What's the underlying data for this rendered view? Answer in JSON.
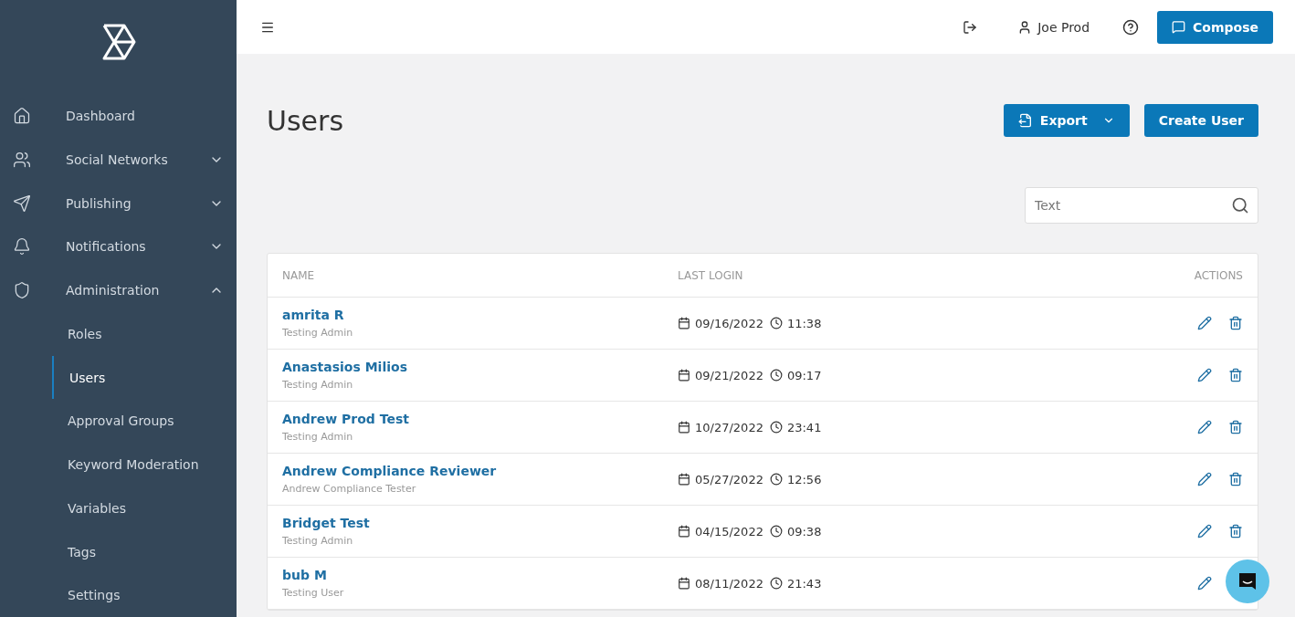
{
  "sidebar": {
    "items": [
      {
        "label": "Dashboard"
      },
      {
        "label": "Social Networks",
        "expanded": false
      },
      {
        "label": "Publishing",
        "expanded": false
      },
      {
        "label": "Notifications",
        "expanded": false
      },
      {
        "label": "Administration",
        "expanded": true,
        "children": [
          {
            "label": "Roles",
            "selected": false
          },
          {
            "label": "Users",
            "selected": true
          },
          {
            "label": "Approval Groups",
            "selected": false
          },
          {
            "label": "Keyword Moderation",
            "selected": false
          },
          {
            "label": "Variables",
            "selected": false
          },
          {
            "label": "Tags",
            "selected": false
          },
          {
            "label": "Settings",
            "selected": false
          }
        ]
      }
    ]
  },
  "header": {
    "user": "Joe Prod",
    "compose": "Compose"
  },
  "page": {
    "title": "Users",
    "export": "Export",
    "create": "Create User",
    "search": {
      "placeholder": "Text"
    }
  },
  "table": {
    "columns": [
      "NAME",
      "LAST LOGIN",
      "ACTIONS"
    ],
    "rows": [
      {
        "name": "amrita R",
        "role": "Testing Admin",
        "date": "09/16/2022",
        "time": "11:38"
      },
      {
        "name": "Anastasios Milios",
        "role": "Testing Admin",
        "date": "09/21/2022",
        "time": "09:17"
      },
      {
        "name": "Andrew Prod Test",
        "role": "Testing Admin",
        "date": "10/27/2022",
        "time": "23:41"
      },
      {
        "name": "Andrew Compliance Reviewer",
        "role": "Andrew Compliance Tester",
        "date": "05/27/2022",
        "time": "12:56"
      },
      {
        "name": "Bridget Test",
        "role": "Testing Admin",
        "date": "04/15/2022",
        "time": "09:38"
      },
      {
        "name": "bub M",
        "role": "Testing User",
        "date": "08/11/2022",
        "time": "21:43"
      }
    ]
  }
}
